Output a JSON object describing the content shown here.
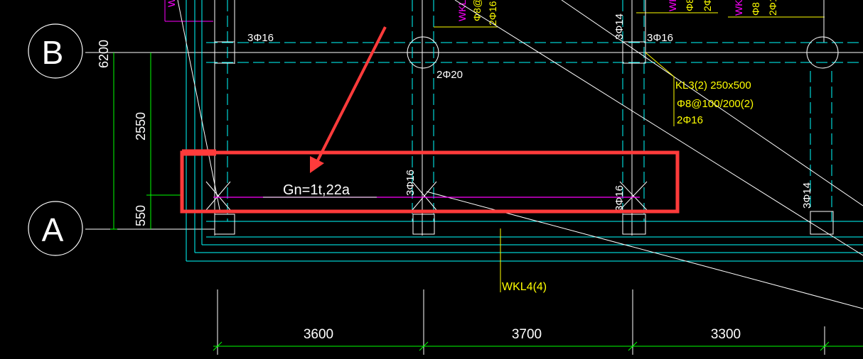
{
  "axes": {
    "b_label": "B",
    "a_label": "A"
  },
  "dimensions": {
    "v_6200": "6200",
    "v_2550": "2550",
    "v_550": "550",
    "h_3600": "3600",
    "h_3700": "3700",
    "h_3300": "3300"
  },
  "annotations": {
    "top_left_3phi16": "3Φ16",
    "top_right_3phi16": "3Φ16",
    "col_3phi14_top": "3Φ14",
    "two_phi20": "2Φ20",
    "kl3_line1": "KL3(2) 250x500",
    "kl3_line2": "Φ8@100/200(2)",
    "kl3_line3": "2Φ16",
    "gn_label": "Gn=1t,22a",
    "col_3phi16_mid": "3Φ16",
    "col_3phi16_right": "3Φ16",
    "col_3phi14_right": "3Φ14",
    "wkl4": "WKL4(4)",
    "top_wkl_1": "WKL",
    "top_wkl_2": "WKL",
    "top_wkl_3": "WKL",
    "top_phi8_1": "Φ8@",
    "top_2phi16_1": "2Φ16",
    "top_phi8_2": "Φ8",
    "top_2phi16_2": "2Φ16"
  },
  "colors": {
    "background": "#000000",
    "white_lines": "#ffffff",
    "cyan_lines": "#00ffff",
    "green_dims": "#00ff00",
    "yellow_text": "#ffff00",
    "magenta_text": "#ff00ff",
    "highlight_red": "#ff3b3b"
  }
}
